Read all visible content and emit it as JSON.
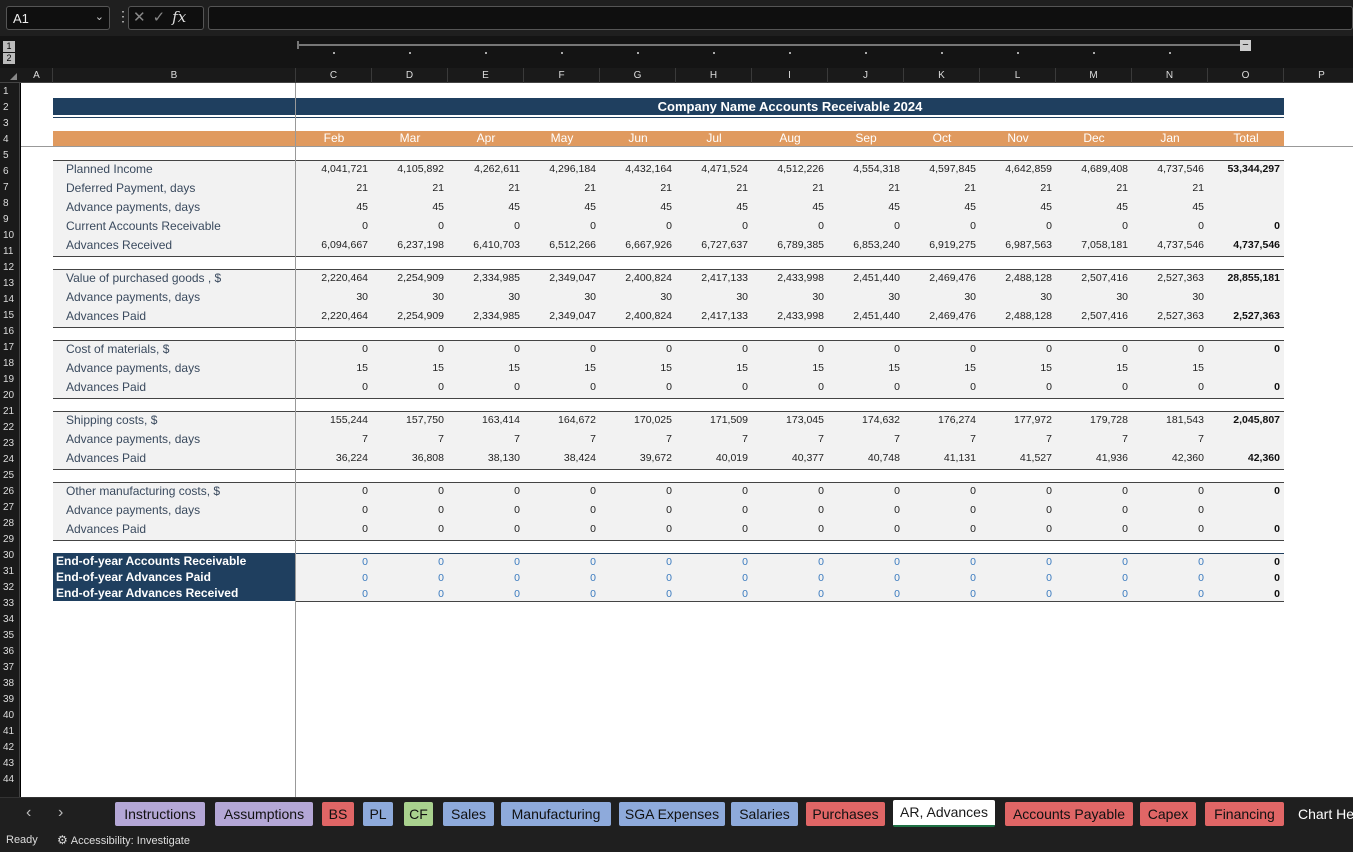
{
  "formula_bar": {
    "name_box": "A1",
    "chevron": "⌄",
    "dots": "⋮",
    "cancel_icon": "✕",
    "enter_icon": "✓",
    "fx_label": "fx",
    "formula": ""
  },
  "outline": {
    "level1": "1",
    "level2": "2",
    "collapse": "−"
  },
  "columns": [
    "A",
    "B",
    "C",
    "D",
    "E",
    "F",
    "G",
    "H",
    "I",
    "J",
    "K",
    "L",
    "M",
    "N",
    "O",
    "P"
  ],
  "rows": [
    "1",
    "2",
    "3",
    "4",
    "5",
    "6",
    "7",
    "8",
    "9",
    "10",
    "11",
    "12",
    "13",
    "14",
    "15",
    "16",
    "17",
    "18",
    "19",
    "20",
    "21",
    "22",
    "23",
    "24",
    "25",
    "26",
    "27",
    "28",
    "29",
    "30",
    "31",
    "32",
    "33",
    "34",
    "35",
    "36",
    "37",
    "38",
    "39",
    "40",
    "41",
    "42",
    "43",
    "44"
  ],
  "sheet": {
    "title": "Company Name Accounts Receivable 2024",
    "months": [
      "Feb",
      "Mar",
      "Apr",
      "May",
      "Jun",
      "Jul",
      "Aug",
      "Sep",
      "Oct",
      "Nov",
      "Dec",
      "Jan",
      "Total"
    ],
    "blocks": [
      {
        "rows": [
          {
            "label": "Planned Income",
            "values": [
              "4,041,721",
              "4,105,892",
              "4,262,611",
              "4,296,184",
              "4,432,164",
              "4,471,524",
              "4,512,226",
              "4,554,318",
              "4,597,845",
              "4,642,859",
              "4,689,408",
              "4,737,546",
              "53,344,297"
            ]
          },
          {
            "label": "Deferred Payment, days",
            "values": [
              "21",
              "21",
              "21",
              "21",
              "21",
              "21",
              "21",
              "21",
              "21",
              "21",
              "21",
              "21",
              ""
            ]
          },
          {
            "label": "Advance payments, days",
            "values": [
              "45",
              "45",
              "45",
              "45",
              "45",
              "45",
              "45",
              "45",
              "45",
              "45",
              "45",
              "45",
              ""
            ]
          },
          {
            "label": "Current Accounts Receivable",
            "values": [
              "0",
              "0",
              "0",
              "0",
              "0",
              "0",
              "0",
              "0",
              "0",
              "0",
              "0",
              "0",
              "0"
            ]
          },
          {
            "label": "Advances Received",
            "values": [
              "6,094,667",
              "6,237,198",
              "6,410,703",
              "6,512,266",
              "6,667,926",
              "6,727,637",
              "6,789,385",
              "6,853,240",
              "6,919,275",
              "6,987,563",
              "7,058,181",
              "4,737,546",
              "4,737,546"
            ]
          }
        ]
      },
      {
        "rows": [
          {
            "label": "Value of purchased goods , $",
            "values": [
              "2,220,464",
              "2,254,909",
              "2,334,985",
              "2,349,047",
              "2,400,824",
              "2,417,133",
              "2,433,998",
              "2,451,440",
              "2,469,476",
              "2,488,128",
              "2,507,416",
              "2,527,363",
              "28,855,181"
            ]
          },
          {
            "label": "Advance payments, days",
            "values": [
              "30",
              "30",
              "30",
              "30",
              "30",
              "30",
              "30",
              "30",
              "30",
              "30",
              "30",
              "30",
              ""
            ]
          },
          {
            "label": "Advances Paid",
            "values": [
              "2,220,464",
              "2,254,909",
              "2,334,985",
              "2,349,047",
              "2,400,824",
              "2,417,133",
              "2,433,998",
              "2,451,440",
              "2,469,476",
              "2,488,128",
              "2,507,416",
              "2,527,363",
              "2,527,363"
            ]
          }
        ]
      },
      {
        "rows": [
          {
            "label": "Cost of materials, $",
            "values": [
              "0",
              "0",
              "0",
              "0",
              "0",
              "0",
              "0",
              "0",
              "0",
              "0",
              "0",
              "0",
              "0"
            ]
          },
          {
            "label": "Advance payments, days",
            "values": [
              "15",
              "15",
              "15",
              "15",
              "15",
              "15",
              "15",
              "15",
              "15",
              "15",
              "15",
              "15",
              ""
            ]
          },
          {
            "label": "Advances Paid",
            "values": [
              "0",
              "0",
              "0",
              "0",
              "0",
              "0",
              "0",
              "0",
              "0",
              "0",
              "0",
              "0",
              "0"
            ]
          }
        ]
      },
      {
        "rows": [
          {
            "label": "Shipping costs, $",
            "values": [
              "155,244",
              "157,750",
              "163,414",
              "164,672",
              "170,025",
              "171,509",
              "173,045",
              "174,632",
              "176,274",
              "177,972",
              "179,728",
              "181,543",
              "2,045,807"
            ]
          },
          {
            "label": "Advance payments, days",
            "values": [
              "7",
              "7",
              "7",
              "7",
              "7",
              "7",
              "7",
              "7",
              "7",
              "7",
              "7",
              "7",
              ""
            ]
          },
          {
            "label": "Advances Paid",
            "values": [
              "36,224",
              "36,808",
              "38,130",
              "38,424",
              "39,672",
              "40,019",
              "40,377",
              "40,748",
              "41,131",
              "41,527",
              "41,936",
              "42,360",
              "42,360"
            ]
          }
        ]
      },
      {
        "rows": [
          {
            "label": "Other manufacturing costs, $",
            "values": [
              "0",
              "0",
              "0",
              "0",
              "0",
              "0",
              "0",
              "0",
              "0",
              "0",
              "0",
              "0",
              "0"
            ]
          },
          {
            "label": "Advance payments, days",
            "values": [
              "0",
              "0",
              "0",
              "0",
              "0",
              "0",
              "0",
              "0",
              "0",
              "0",
              "0",
              "0",
              ""
            ]
          },
          {
            "label": "Advances Paid",
            "values": [
              "0",
              "0",
              "0",
              "0",
              "0",
              "0",
              "0",
              "0",
              "0",
              "0",
              "0",
              "0",
              "0"
            ]
          }
        ]
      }
    ],
    "eoy": [
      {
        "label": "End-of-year Accounts Receivable",
        "values": [
          "0",
          "0",
          "0",
          "0",
          "0",
          "0",
          "0",
          "0",
          "0",
          "0",
          "0",
          "0",
          "0"
        ]
      },
      {
        "label": "End-of-year Advances Paid",
        "values": [
          "0",
          "0",
          "0",
          "0",
          "0",
          "0",
          "0",
          "0",
          "0",
          "0",
          "0",
          "0",
          "0"
        ]
      },
      {
        "label": "End-of-year Advances Received",
        "values": [
          "0",
          "0",
          "0",
          "0",
          "0",
          "0",
          "0",
          "0",
          "0",
          "0",
          "0",
          "0",
          "0"
        ]
      }
    ]
  },
  "tabs": {
    "prev": "‹",
    "next": "›",
    "items": [
      {
        "label": "Instructions",
        "color": "#b4a7d6"
      },
      {
        "label": "Assumptions",
        "color": "#b4a7d6"
      },
      {
        "label": "BS",
        "color": "#e06666"
      },
      {
        "label": "PL",
        "color": "#8eaadb"
      },
      {
        "label": "CF",
        "color": "#a9d18e"
      },
      {
        "label": "Sales",
        "color": "#8eaadb"
      },
      {
        "label": "Manufacturing",
        "color": "#8eaadb"
      },
      {
        "label": "SGA Expenses",
        "color": "#8eaadb"
      },
      {
        "label": "Salaries",
        "color": "#8eaadb"
      },
      {
        "label": "Purchases",
        "color": "#e06666"
      },
      {
        "label": "AR, Advances",
        "color": "#ffffff",
        "active": true
      },
      {
        "label": "Accounts Payable",
        "color": "#e06666"
      },
      {
        "label": "Capex",
        "color": "#e06666"
      },
      {
        "label": "Financing",
        "color": "#e06666"
      },
      {
        "label": "Chart He",
        "color": ""
      }
    ]
  },
  "status": {
    "ready": "Ready",
    "accessibility": "Accessibility: Investigate",
    "acc_icon": "accessibility-icon"
  }
}
